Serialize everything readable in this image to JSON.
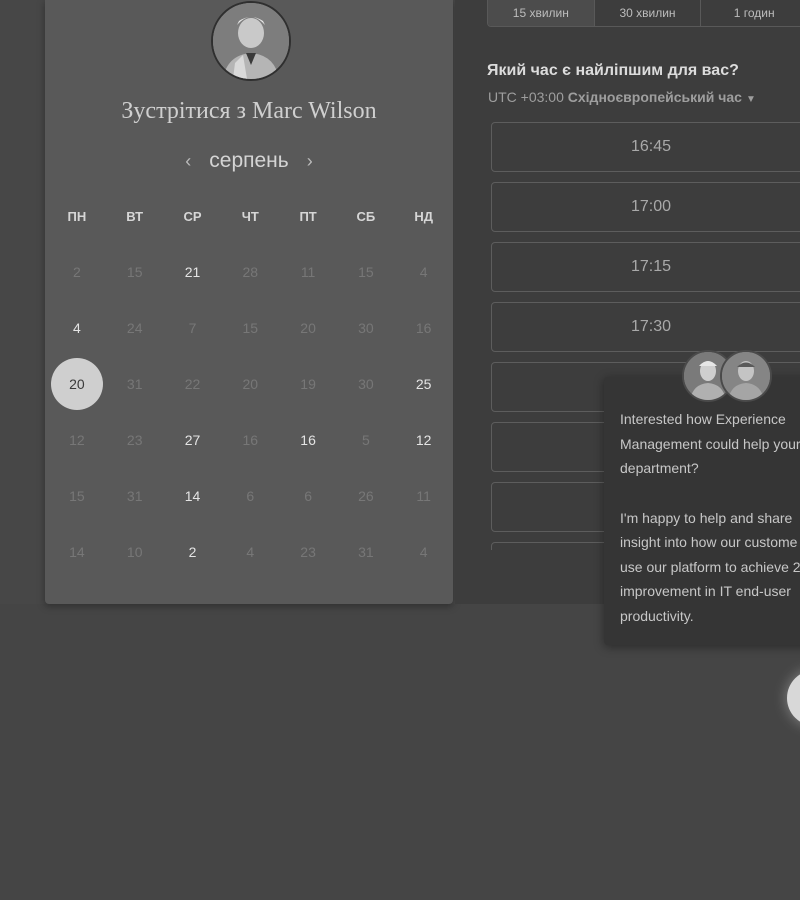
{
  "calendar": {
    "title": "Зустрітися з Marc Wilson",
    "month": "серпень",
    "prev_icon": "chevron-left-icon",
    "next_icon": "chevron-right-icon",
    "weekdays": [
      "ПН",
      "ВТ",
      "СР",
      "ЧТ",
      "ПТ",
      "СБ",
      "НД"
    ],
    "weeks": [
      [
        {
          "d": "2",
          "s": "dim"
        },
        {
          "d": "15",
          "s": "dim"
        },
        {
          "d": "21",
          "s": "bright"
        },
        {
          "d": "28",
          "s": "dim"
        },
        {
          "d": "11",
          "s": "dim"
        },
        {
          "d": "15",
          "s": "dim"
        },
        {
          "d": "4",
          "s": "dim"
        }
      ],
      [
        {
          "d": "4",
          "s": "bright"
        },
        {
          "d": "24",
          "s": "dim"
        },
        {
          "d": "7",
          "s": "dim"
        },
        {
          "d": "15",
          "s": "dim"
        },
        {
          "d": "20",
          "s": "dim"
        },
        {
          "d": "30",
          "s": "dim"
        },
        {
          "d": "16",
          "s": "dim"
        }
      ],
      [
        {
          "d": "20",
          "s": "selected"
        },
        {
          "d": "31",
          "s": "dim"
        },
        {
          "d": "22",
          "s": "dim"
        },
        {
          "d": "20",
          "s": "dim"
        },
        {
          "d": "19",
          "s": "dim"
        },
        {
          "d": "30",
          "s": "dim"
        },
        {
          "d": "25",
          "s": "bright"
        }
      ],
      [
        {
          "d": "12",
          "s": "dim"
        },
        {
          "d": "23",
          "s": "dim"
        },
        {
          "d": "27",
          "s": "bright"
        },
        {
          "d": "16",
          "s": "dim"
        },
        {
          "d": "16",
          "s": "bright"
        },
        {
          "d": "5",
          "s": "dim"
        },
        {
          "d": "12",
          "s": "bright"
        }
      ],
      [
        {
          "d": "15",
          "s": "dim"
        },
        {
          "d": "31",
          "s": "dim"
        },
        {
          "d": "14",
          "s": "bright"
        },
        {
          "d": "6",
          "s": "dim"
        },
        {
          "d": "6",
          "s": "dim"
        },
        {
          "d": "26",
          "s": "dim"
        },
        {
          "d": "11",
          "s": "dim"
        }
      ],
      [
        {
          "d": "14",
          "s": "dim"
        },
        {
          "d": "10",
          "s": "dim"
        },
        {
          "d": "2",
          "s": "bright"
        },
        {
          "d": "4",
          "s": "dim"
        },
        {
          "d": "23",
          "s": "dim"
        },
        {
          "d": "31",
          "s": "dim"
        },
        {
          "d": "4",
          "s": "dim"
        }
      ]
    ]
  },
  "durations": {
    "tabs": [
      "15 хвилин",
      "30 хвилин",
      "1 годин"
    ],
    "active": 0
  },
  "schedule": {
    "question": "Який час є найліпшим для вас?",
    "tz_prefix": "UTC +03:00",
    "tz_name": "Східноєвропейський час",
    "tz_icon": "caret-down-icon",
    "slots": [
      "16:45",
      "17:00",
      "17:15",
      "17:30",
      "",
      "",
      "",
      ""
    ]
  },
  "chat": {
    "paragraphs": [
      [
        "Interested how Experience",
        "Management could help your",
        "department?"
      ],
      [
        "I'm happy to help and share",
        "insight into how our custome",
        "use our platform to achieve 2",
        "improvement in IT end-user",
        "productivity."
      ]
    ]
  },
  "colors": {
    "card": "#595959",
    "panel": "#3d3d3d",
    "selected_day": "#cfcfcf"
  }
}
